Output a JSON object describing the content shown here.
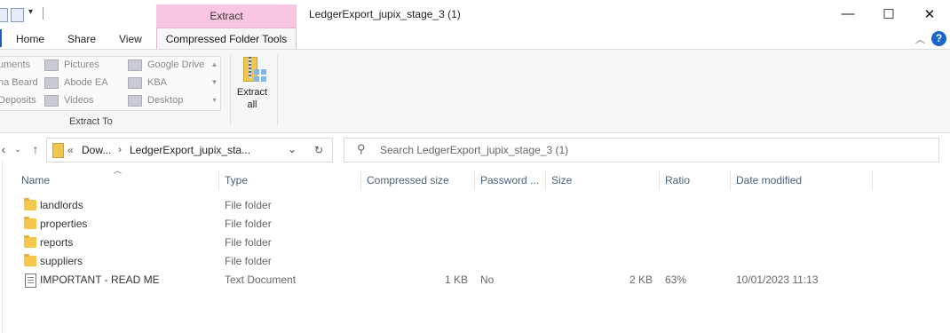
{
  "window": {
    "title": "LedgerExport_jupix_stage_3 (1)",
    "contextual_group": "Extract",
    "controls": {
      "minimize": "—",
      "maximize": "☐",
      "close": "✕"
    }
  },
  "tabs": {
    "home": "Home",
    "share": "Share",
    "view": "View",
    "compressed_folder_tools": "Compressed Folder Tools"
  },
  "ribbon": {
    "extract_to_items": [
      {
        "label": "uments"
      },
      {
        "label": "Pictures"
      },
      {
        "label": "Google Drive"
      },
      {
        "label": "na Beard"
      },
      {
        "label": "Abode EA"
      },
      {
        "label": "KBA"
      },
      {
        "label": "Deposits"
      },
      {
        "label": "Videos"
      },
      {
        "label": "Desktop"
      }
    ],
    "extract_to_label": "Extract To",
    "extract_all_line1": "Extract",
    "extract_all_line2": "all"
  },
  "address": {
    "prefix": "«",
    "crumb1": "Dow...",
    "crumb2": "LedgerExport_jupix_sta...",
    "search_placeholder": "Search LedgerExport_jupix_stage_3 (1)"
  },
  "columns": {
    "name": "Name",
    "type": "Type",
    "compressed_size": "Compressed size",
    "password": "Password ...",
    "size": "Size",
    "ratio": "Ratio",
    "date_modified": "Date modified"
  },
  "files": [
    {
      "name": "landlords",
      "type": "File folder",
      "compressed": "",
      "password": "",
      "size": "",
      "ratio": "",
      "date": "",
      "kind": "folder"
    },
    {
      "name": "properties",
      "type": "File folder",
      "compressed": "",
      "password": "",
      "size": "",
      "ratio": "",
      "date": "",
      "kind": "folder"
    },
    {
      "name": "reports",
      "type": "File folder",
      "compressed": "",
      "password": "",
      "size": "",
      "ratio": "",
      "date": "",
      "kind": "folder"
    },
    {
      "name": "suppliers",
      "type": "File folder",
      "compressed": "",
      "password": "",
      "size": "",
      "ratio": "",
      "date": "",
      "kind": "folder"
    },
    {
      "name": "IMPORTANT - READ ME",
      "type": "Text Document",
      "compressed": "1 KB",
      "password": "No",
      "size": "2 KB",
      "ratio": "63%",
      "date": "10/01/2023 11:13",
      "kind": "document"
    }
  ]
}
